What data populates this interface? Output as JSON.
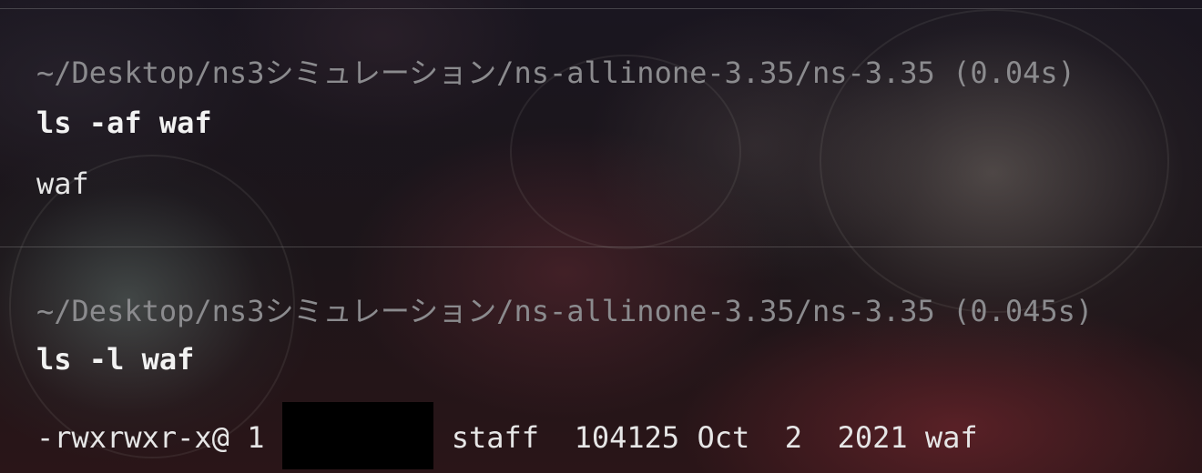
{
  "blocks": [
    {
      "prompt": "~/Desktop/ns3シミュレーション/ns-allinone-3.35/ns-3.35 (0.04s)",
      "command": "ls -af waf",
      "output": "waf"
    },
    {
      "prompt": "~/Desktop/ns3シミュレーション/ns-allinone-3.35/ns-3.35 (0.045s)",
      "command": "ls -l waf",
      "output": {
        "permissions": "-rwxrwxr-x@",
        "links": "1",
        "owner_redacted": true,
        "group": "staff",
        "size": "104125",
        "month": "Oct",
        "day": "2",
        "year": "2021",
        "name": "waf"
      }
    }
  ],
  "colors": {
    "prompt": "#8b8b8e",
    "command": "#f2f2f2",
    "output": "#e6e6e6",
    "redaction": "#000000"
  }
}
